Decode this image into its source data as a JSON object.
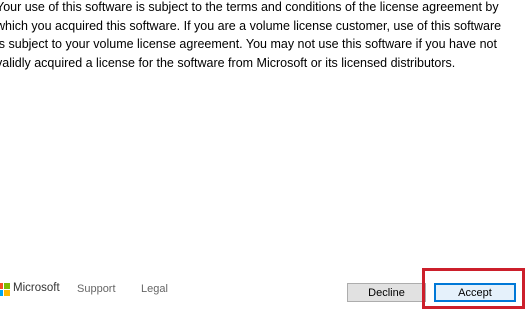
{
  "license": {
    "lines": [
      "Your use of this software is subject to the terms and conditions of the license agreement by",
      "which you acquired this software.  If you are a volume license customer, use of this software",
      "is subject to your volume license agreement.  You may not use this software if you have not",
      "validly acquired a license for the software from Microsoft or its licensed distributors."
    ]
  },
  "footer": {
    "brand": "Microsoft",
    "logo_colors": [
      "#f25022",
      "#7fba00",
      "#00a4ef",
      "#ffb900"
    ],
    "support_label": "Support",
    "legal_label": "Legal"
  },
  "buttons": {
    "decline_label": "Decline",
    "accept_label": "Accept"
  },
  "colors": {
    "highlight": "#cc1f2b",
    "accent": "#0078d7"
  }
}
